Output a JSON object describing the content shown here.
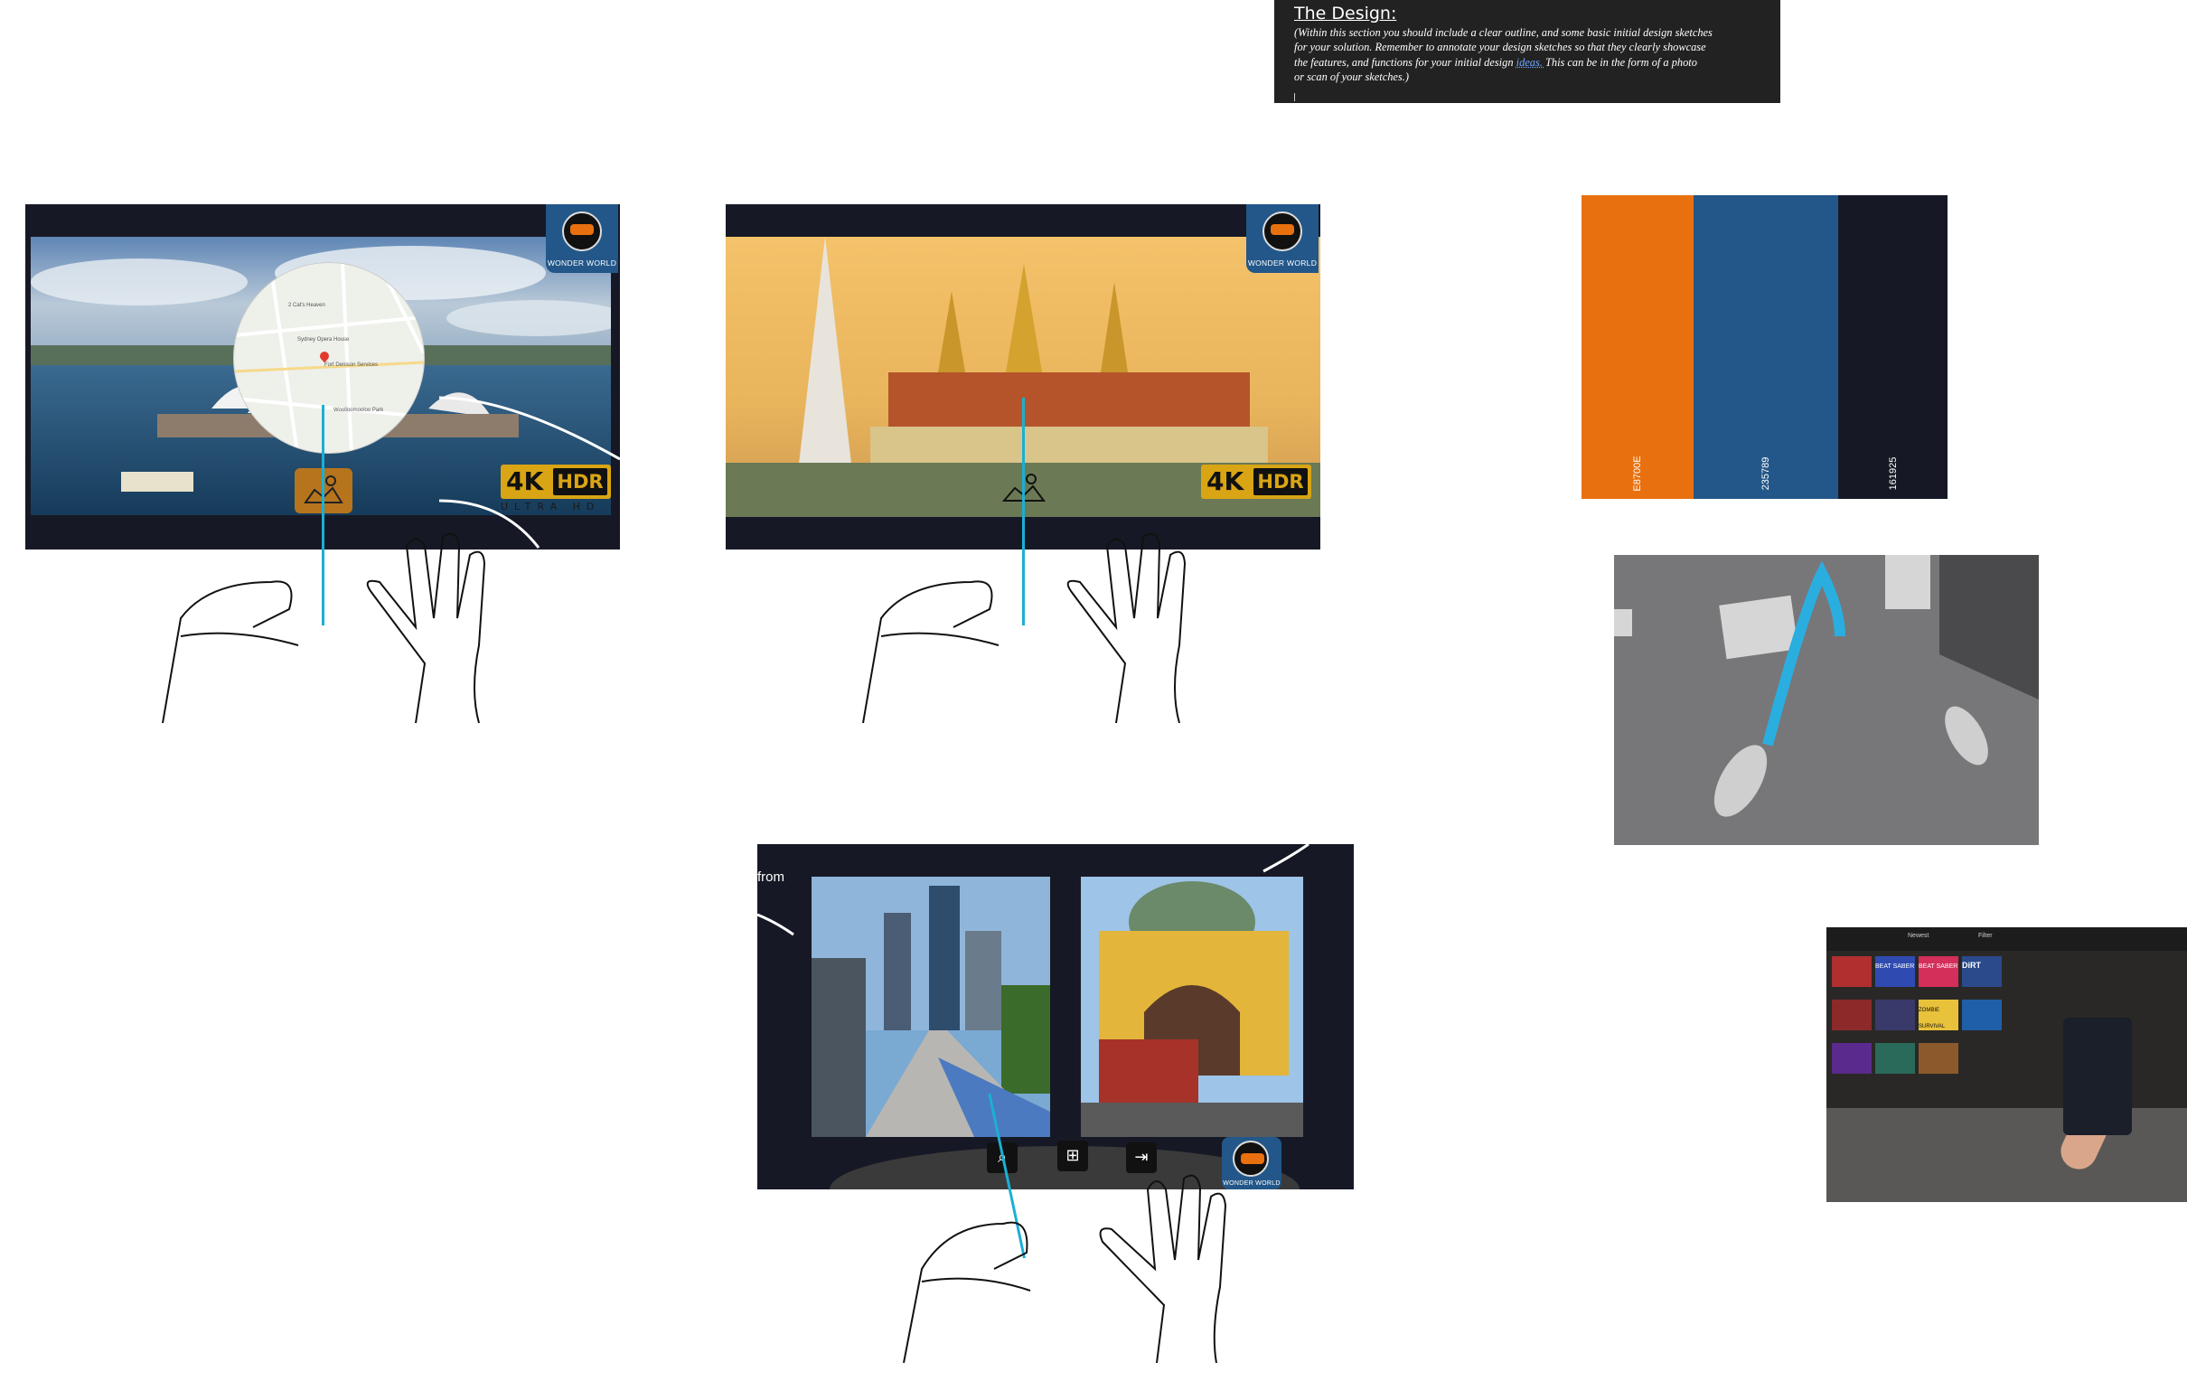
{
  "note": {
    "title": "The Design:",
    "body_lines": [
      "(Within this section you should include a clear outline, and some basic initial design sketches",
      "for your solution. Remember to annotate your design sketches so that they clearly showcase",
      "the features, and functions for your initial design ",
      "ideas. ",
      " This can be in the form of a photo",
      "or scan of your sketches.)"
    ]
  },
  "panels": {
    "logo_text": "WONDER WORLD",
    "badge_4k": "4K",
    "badge_hdr": "HDR",
    "badge_uhd": "ULTRA HD",
    "map_labels": [
      "2 Cat's Heaven",
      "Sydney Opera House",
      "Fort Denison Services",
      "Woolloomooloo Park"
    ]
  },
  "grid_panel": {
    "partial_text": "from",
    "toolbar": {
      "search_icon": "search-icon",
      "grid_icon": "grid-icon",
      "exit_icon": "exit-icon"
    }
  },
  "palette": {
    "swatches": [
      {
        "hex": "E8700E",
        "color": "#E8700E"
      },
      {
        "hex": "235789",
        "color": "#235789"
      },
      {
        "hex": "161925",
        "color": "#161925"
      }
    ]
  },
  "library": {
    "tiles": [
      "BEAT SABER",
      "BEAT SABER",
      "DiRT",
      "ZOMBIE SURVIVAL"
    ],
    "menu_items": [
      "Newest",
      "Filter"
    ]
  }
}
